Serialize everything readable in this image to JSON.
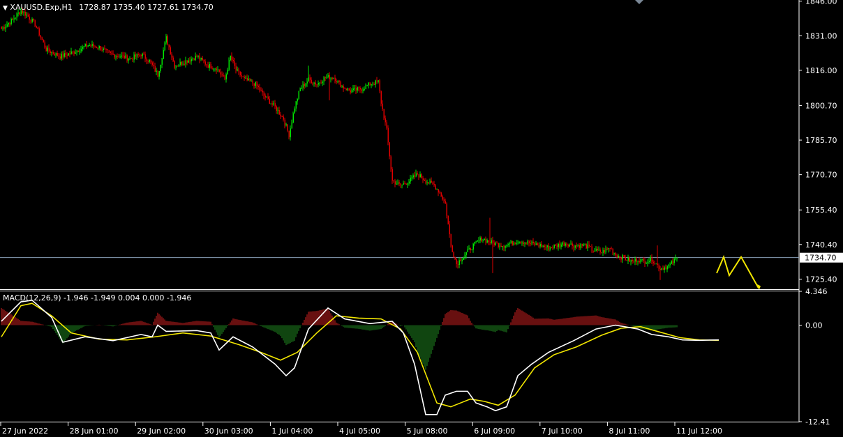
{
  "header": {
    "symbol": "XAUUSD.Exp,H1",
    "ohlc": "1728.87 1735.40 1727.61 1734.70"
  },
  "macd_header": "MACD(12,26,9) -1.946 -1.949 0.004 0.000 -1.946",
  "colors": {
    "background": "#000000",
    "bull": "#00e600",
    "bear": "#e00000",
    "hist_pos": "#d02020",
    "hist_neg": "#1f8a1f",
    "macd_line": "#ffffff",
    "signal_line": "#f2e600",
    "arrow": "#f2e600",
    "axis": "#ffffff",
    "price_line": "#8aa0b8"
  },
  "chart_data": [
    {
      "type": "candlestick",
      "title": "XAUUSD.Exp,H1",
      "x_ticks": [
        "27 Jun 2022",
        "28 Jun 01:00",
        "29 Jun 02:00",
        "30 Jun 03:00",
        "1 Jul 04:00",
        "4 Jul 05:00",
        "5 Jul 08:00",
        "6 Jul 09:00",
        "7 Jul 10:00",
        "8 Jul 11:00",
        "11 Jul 12:00"
      ],
      "y_ticks": [
        "1846.00",
        "1831.00",
        "1816.00",
        "1800.70",
        "1785.70",
        "1770.70",
        "1755.40",
        "1740.40",
        "1725.40"
      ],
      "ylim": [
        1721.6,
        1846.5
      ],
      "current_price": "1734.70",
      "path": [
        [
          0,
          1834
        ],
        [
          8,
          1838
        ],
        [
          14,
          1842
        ],
        [
          18,
          1840
        ],
        [
          24,
          1836
        ],
        [
          32,
          1825
        ],
        [
          42,
          1822
        ],
        [
          52,
          1824
        ],
        [
          62,
          1827
        ],
        [
          70,
          1826
        ],
        [
          78,
          1823
        ],
        [
          86,
          1822
        ],
        [
          92,
          1821
        ],
        [
          100,
          1823
        ],
        [
          106,
          1820
        ],
        [
          112,
          1814
        ],
        [
          118,
          1830
        ],
        [
          124,
          1818
        ],
        [
          132,
          1820
        ],
        [
          140,
          1822
        ],
        [
          148,
          1818
        ],
        [
          154,
          1817
        ],
        [
          160,
          1812
        ],
        [
          164,
          1822
        ],
        [
          168,
          1816
        ],
        [
          174,
          1812
        ],
        [
          182,
          1810
        ],
        [
          188,
          1805
        ],
        [
          196,
          1800
        ],
        [
          202,
          1795
        ],
        [
          206,
          1788
        ],
        [
          210,
          1800
        ],
        [
          214,
          1808
        ],
        [
          220,
          1812
        ],
        [
          226,
          1810
        ],
        [
          232,
          1813
        ],
        [
          238,
          1813
        ],
        [
          244,
          1809
        ],
        [
          250,
          1807
        ],
        [
          258,
          1808
        ],
        [
          264,
          1810
        ],
        [
          270,
          1811
        ],
        [
          272,
          1802
        ],
        [
          276,
          1790
        ],
        [
          280,
          1768
        ],
        [
          286,
          1766
        ],
        [
          292,
          1768
        ],
        [
          298,
          1771
        ],
        [
          304,
          1768
        ],
        [
          310,
          1766
        ],
        [
          314,
          1763
        ],
        [
          318,
          1758
        ],
        [
          322,
          1740
        ],
        [
          326,
          1732
        ],
        [
          332,
          1736
        ],
        [
          338,
          1740
        ],
        [
          344,
          1743
        ],
        [
          352,
          1741
        ],
        [
          360,
          1740
        ],
        [
          370,
          1742
        ],
        [
          378,
          1741
        ],
        [
          386,
          1740
        ],
        [
          392,
          1739
        ],
        [
          398,
          1740
        ],
        [
          404,
          1741
        ],
        [
          410,
          1740
        ],
        [
          418,
          1740
        ],
        [
          424,
          1738
        ],
        [
          430,
          1737
        ],
        [
          436,
          1739
        ],
        [
          440,
          1736
        ],
        [
          444,
          1735
        ],
        [
          448,
          1734
        ],
        [
          452,
          1733
        ],
        [
          456,
          1734
        ],
        [
          460,
          1733
        ],
        [
          466,
          1734
        ],
        [
          472,
          1730
        ],
        [
          478,
          1731
        ],
        [
          484,
          1734.7
        ]
      ],
      "spikes": [
        [
          220,
          1818
        ],
        [
          235,
          1803
        ],
        [
          350,
          1752
        ],
        [
          352,
          1728
        ],
        [
          380,
          1740
        ],
        [
          470,
          1740
        ],
        [
          472,
          1725
        ]
      ],
      "projection": [
        [
          1027,
          1728
        ],
        [
          1037,
          1735
        ],
        [
          1045,
          1727
        ],
        [
          1062,
          1735
        ],
        [
          1087,
          1721.5
        ]
      ]
    },
    {
      "type": "macd",
      "name": "MACD(12,26,9)",
      "values": [
        -1.946,
        -1.949,
        0.004,
        0.0,
        -1.946
      ],
      "y_ticks": [
        "4.346",
        "0.00",
        "-12.41"
      ],
      "ylim": [
        -12.41,
        4.346
      ],
      "macd_line": [
        [
          0,
          0.5
        ],
        [
          14,
          3.0
        ],
        [
          22,
          3.2
        ],
        [
          36,
          1.0
        ],
        [
          44,
          -2.2
        ],
        [
          60,
          -1.5
        ],
        [
          80,
          -2.0
        ],
        [
          100,
          -1.2
        ],
        [
          108,
          -1.5
        ],
        [
          112,
          0.0
        ],
        [
          118,
          -0.8
        ],
        [
          140,
          -0.7
        ],
        [
          150,
          -1.0
        ],
        [
          156,
          -3.2
        ],
        [
          166,
          -1.5
        ],
        [
          180,
          -2.8
        ],
        [
          196,
          -5.0
        ],
        [
          204,
          -6.5
        ],
        [
          210,
          -5.5
        ],
        [
          220,
          -0.5
        ],
        [
          234,
          2.2
        ],
        [
          246,
          0.8
        ],
        [
          264,
          0.2
        ],
        [
          280,
          0.5
        ],
        [
          288,
          -1.0
        ],
        [
          296,
          -5.0
        ],
        [
          304,
          -11.5
        ],
        [
          312,
          -11.5
        ],
        [
          318,
          -9.0
        ],
        [
          326,
          -8.5
        ],
        [
          334,
          -8.5
        ],
        [
          340,
          -10.0
        ],
        [
          348,
          -10.5
        ],
        [
          354,
          -11.0
        ],
        [
          362,
          -10.5
        ],
        [
          370,
          -6.5
        ],
        [
          380,
          -5.0
        ],
        [
          392,
          -3.5
        ],
        [
          410,
          -2.0
        ],
        [
          426,
          -0.5
        ],
        [
          440,
          0.0
        ],
        [
          456,
          -0.5
        ],
        [
          466,
          -1.2
        ],
        [
          478,
          -1.5
        ],
        [
          488,
          -1.9
        ],
        [
          500,
          -1.95
        ],
        [
          514,
          -1.9
        ]
      ],
      "signal_line": [
        [
          0,
          -1.5
        ],
        [
          14,
          2.5
        ],
        [
          22,
          2.8
        ],
        [
          36,
          1.2
        ],
        [
          50,
          -1.0
        ],
        [
          70,
          -1.8
        ],
        [
          90,
          -1.9
        ],
        [
          110,
          -1.5
        ],
        [
          130,
          -1.0
        ],
        [
          150,
          -1.4
        ],
        [
          170,
          -2.5
        ],
        [
          186,
          -3.5
        ],
        [
          200,
          -4.5
        ],
        [
          212,
          -3.5
        ],
        [
          226,
          -1.0
        ],
        [
          240,
          1.2
        ],
        [
          256,
          0.9
        ],
        [
          272,
          0.8
        ],
        [
          286,
          -0.5
        ],
        [
          298,
          -3.5
        ],
        [
          312,
          -10.0
        ],
        [
          322,
          -10.5
        ],
        [
          336,
          -9.5
        ],
        [
          346,
          -9.8
        ],
        [
          356,
          -10.3
        ],
        [
          368,
          -9.0
        ],
        [
          382,
          -5.5
        ],
        [
          396,
          -3.8
        ],
        [
          412,
          -2.8
        ],
        [
          430,
          -1.3
        ],
        [
          444,
          -0.4
        ],
        [
          458,
          -0.2
        ],
        [
          472,
          -0.9
        ],
        [
          486,
          -1.6
        ],
        [
          500,
          -1.9
        ],
        [
          514,
          -1.95
        ]
      ]
    }
  ]
}
